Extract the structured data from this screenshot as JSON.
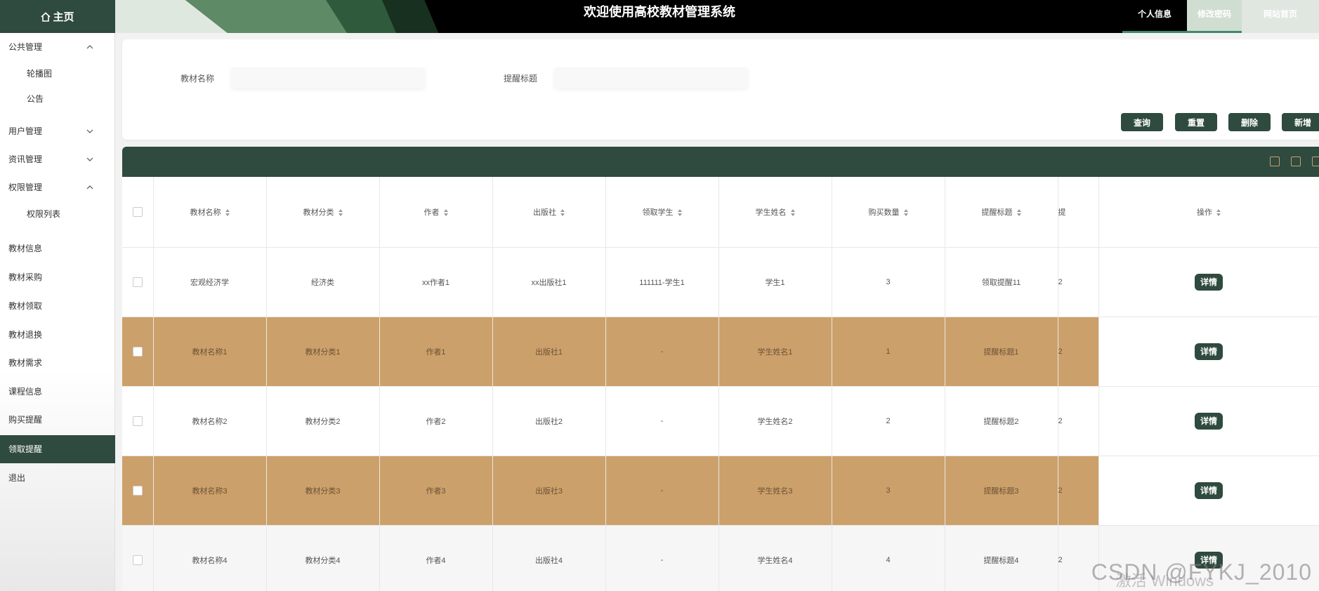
{
  "header": {
    "home_label": "主页",
    "title": "欢迎使用高校教材管理系统",
    "nav": {
      "profile": "个人信息",
      "password": "修改密码",
      "site_home": "网站首页"
    }
  },
  "sidebar": {
    "items": [
      {
        "label": "公共管理",
        "arrow": "up"
      },
      {
        "label": "轮播图"
      },
      {
        "label": "公告"
      },
      {
        "label": "用户管理",
        "arrow": "down"
      },
      {
        "label": "资讯管理",
        "arrow": "down"
      },
      {
        "label": "权限管理",
        "arrow": "up"
      },
      {
        "label": "权限列表"
      },
      {
        "label": "教材信息"
      },
      {
        "label": "教材采购"
      },
      {
        "label": "教材领取"
      },
      {
        "label": "教材退换"
      },
      {
        "label": "教材需求"
      },
      {
        "label": "课程信息"
      },
      {
        "label": "购买提醒"
      },
      {
        "label": "领取提醒",
        "active": true
      },
      {
        "label": "退出"
      }
    ]
  },
  "search": {
    "field1_label": "教材名称",
    "field1_value": "",
    "field2_label": "提醒标题",
    "field2_value": "",
    "buttons": {
      "query": "查询",
      "reset": "重置",
      "delete": "删除",
      "add": "新增"
    }
  },
  "table": {
    "columns": [
      "教材名称",
      "教材分类",
      "作者",
      "出版社",
      "领取学生",
      "学生姓名",
      "购买数量",
      "提醒标题",
      "提",
      "操作"
    ],
    "rows": [
      [
        "宏观经济学",
        "经济类",
        "xx作者1",
        "xx出版社1",
        "111111-学生1",
        "学生1",
        "3",
        "领取提醒11",
        "2"
      ],
      [
        "教材名称1",
        "教材分类1",
        "作者1",
        "出版社1",
        "-",
        "学生姓名1",
        "1",
        "提醒标题1",
        "2"
      ],
      [
        "教材名称2",
        "教材分类2",
        "作者2",
        "出版社2",
        "-",
        "学生姓名2",
        "2",
        "提醒标题2",
        "2"
      ],
      [
        "教材名称3",
        "教材分类3",
        "作者3",
        "出版社3",
        "-",
        "学生姓名3",
        "3",
        "提醒标题3",
        "2"
      ],
      [
        "教材名称4",
        "教材分类4",
        "作者4",
        "出版社4",
        "-",
        "学生姓名4",
        "4",
        "提醒标题4",
        "2"
      ]
    ],
    "detail_label": "详情"
  },
  "watermark": {
    "csdn": "CSDN @FYKJ_2010",
    "windows": "激活 Windows"
  },
  "colors": {
    "primary": "#2f4a3e",
    "row_highlight": "#cca06a",
    "accent_underline": "#3e8a6e"
  }
}
